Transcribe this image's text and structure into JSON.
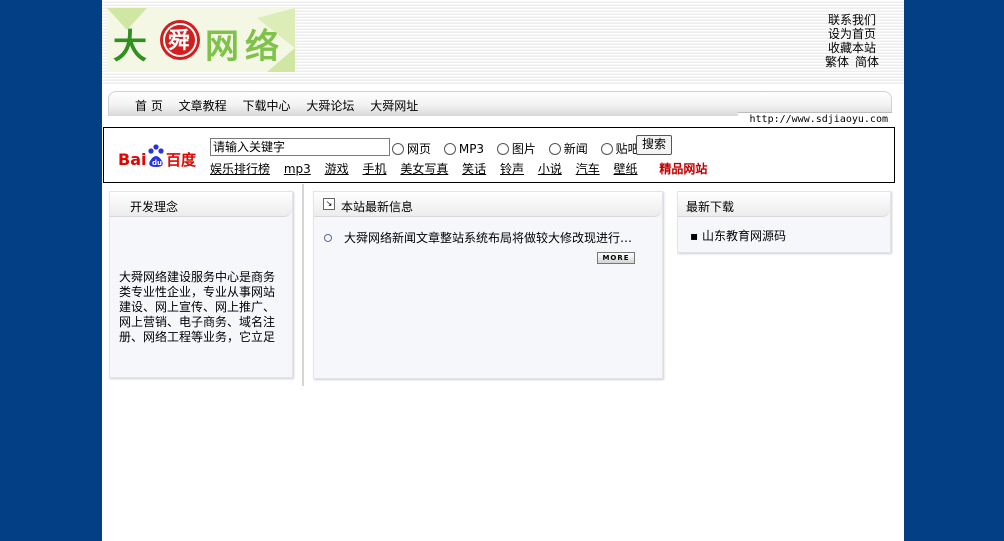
{
  "header": {
    "top_links": [
      "联系我们",
      "设为首页",
      "收藏本站"
    ],
    "lang_links": [
      "繁体",
      "简体"
    ]
  },
  "nav": {
    "items": [
      "首 页",
      "文章教程",
      "下载中心",
      "大舜论坛",
      "大舜网址"
    ],
    "url": "http://www.sdjiaoyu.com"
  },
  "search": {
    "input_value": "请输入关键字",
    "options": [
      "网页",
      "MP3",
      "图片",
      "新闻",
      "贴吧"
    ],
    "button": "搜索",
    "links": [
      "娱乐排行榜",
      "mp3",
      "游戏",
      "手机",
      "美女写真",
      "笑话",
      "铃声",
      "小说",
      "汽车",
      "壁纸"
    ],
    "highlight_link": "精品网站"
  },
  "left_panel": {
    "title": "开发理念",
    "text": "大舜网络建设服务中心是商务类专业性企业，专业从事网站建设、网上宣传、网上推广、网上营销、电子商务、域名注册、网络工程等业务，它立足"
  },
  "center_panel": {
    "title": "本站最新信息",
    "items": [
      "大舜网络新闻文章整站系统布局将做较大修改现进行…"
    ],
    "more": "MORE"
  },
  "right_panel": {
    "title": "最新下载",
    "items": [
      "▪ 山东教育网源码"
    ]
  },
  "colors": {
    "side_background": "#033f85",
    "highlight_red": "#c00000",
    "baidu_blue": "#2932e1"
  }
}
